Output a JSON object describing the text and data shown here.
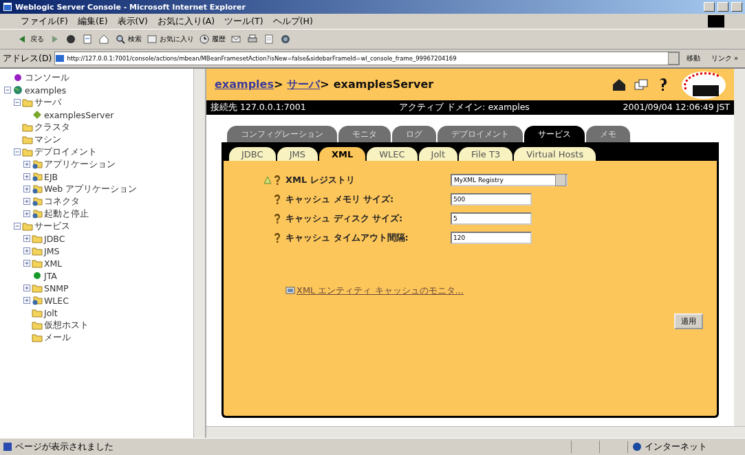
{
  "window": {
    "title": "Weblogic Server Console - Microsoft Internet Explorer"
  },
  "menu": [
    "ファイル(F)",
    "編集(E)",
    "表示(V)",
    "お気に入り(A)",
    "ツール(T)",
    "ヘルプ(H)"
  ],
  "toolbar": [
    {
      "kind": "back",
      "label": "戻る"
    },
    {
      "kind": "forward"
    },
    {
      "kind": "stop"
    },
    {
      "kind": "refresh"
    },
    {
      "kind": "home"
    },
    {
      "kind": "search",
      "label": "検索"
    },
    {
      "kind": "favorites",
      "label": "お気に入り"
    },
    {
      "kind": "history",
      "label": "履歴"
    },
    {
      "kind": "mail"
    },
    {
      "kind": "print"
    },
    {
      "kind": "edit"
    },
    {
      "kind": "messenger"
    }
  ],
  "address": {
    "label": "アドレス(D)",
    "value": "http://127.0.0.1:7001/console/actions/mbean/MBeanFramesetAction?isNew=false&sidebarFrameId=wl_console_frame_99967204169",
    "go": "移動",
    "links": "リンク »"
  },
  "tree": [
    {
      "label": "コンソール",
      "kind": "bullet",
      "color": "#9a1fc4"
    },
    {
      "label": "examples",
      "kind": "globe",
      "expanded": true,
      "children": [
        {
          "label": "サーバ",
          "kind": "folder",
          "expanded": true,
          "children": [
            {
              "label": "examplesServer",
              "kind": "diamond"
            }
          ]
        },
        {
          "label": "クラスタ",
          "kind": "folder"
        },
        {
          "label": "マシン",
          "kind": "folder"
        },
        {
          "label": "デプロイメント",
          "kind": "folder",
          "expanded": true,
          "children": [
            {
              "label": "アプリケーション",
              "kind": "app",
              "expanded": false
            },
            {
              "label": "EJB",
              "kind": "app",
              "expanded": false
            },
            {
              "label": "Web アプリケーション",
              "kind": "app",
              "expanded": false
            },
            {
              "label": "コネクタ",
              "kind": "app",
              "expanded": false
            },
            {
              "label": "起動と停止",
              "kind": "app",
              "expanded": false
            }
          ]
        },
        {
          "label": "サービス",
          "kind": "folder",
          "expanded": true,
          "children": [
            {
              "label": "JDBC",
              "kind": "folder",
              "expanded": false
            },
            {
              "label": "JMS",
              "kind": "folder",
              "expanded": false
            },
            {
              "label": "XML",
              "kind": "folder",
              "expanded": false
            },
            {
              "label": "JTA",
              "kind": "bullet",
              "color": "#1a9a2a"
            },
            {
              "label": "SNMP",
              "kind": "folder",
              "expanded": false
            },
            {
              "label": "WLEC",
              "kind": "app",
              "expanded": false
            },
            {
              "label": "Jolt",
              "kind": "folder"
            },
            {
              "label": "仮想ホスト",
              "kind": "folder"
            },
            {
              "label": "メール",
              "kind": "folder"
            }
          ]
        }
      ]
    }
  ],
  "breadcrumb": [
    {
      "label": "examples",
      "kind": "link",
      "separator": ">"
    },
    {
      "label": "サーバ",
      "kind": "link",
      "separator": ">"
    },
    {
      "label": "examplesServer",
      "kind": "current"
    }
  ],
  "info_bar": {
    "connection": "接続先 127.0.0.1:7001",
    "domain": "アクティブ ドメイン: examples",
    "time": "2001/09/04 12:06:49 JST"
  },
  "tabs": [
    {
      "label": "コンフィグレーション",
      "selected": false
    },
    {
      "label": "モニタ",
      "selected": false
    },
    {
      "label": "ログ",
      "selected": false
    },
    {
      "label": "デプロイメント",
      "selected": false
    },
    {
      "label": "サービス",
      "selected": true
    },
    {
      "label": "メモ",
      "selected": false
    }
  ],
  "subtabs": [
    {
      "label": "JDBC",
      "selected": false
    },
    {
      "label": "JMS",
      "selected": false
    },
    {
      "label": "XML",
      "selected": true
    },
    {
      "label": "WLEC",
      "selected": false
    },
    {
      "label": "Jolt",
      "selected": false
    },
    {
      "label": "File T3",
      "selected": false
    },
    {
      "label": "Virtual Hosts",
      "selected": false
    }
  ],
  "form": [
    {
      "label": "XML レジストリ",
      "kind": "select",
      "value": "MyXML Registry",
      "warning": true
    },
    {
      "label": "キャッシュ メモリ サイズ:",
      "kind": "text",
      "value": "500",
      "warning": false
    },
    {
      "label": "キャッシュ ディスク サイズ:",
      "kind": "text",
      "value": "5",
      "warning": false
    },
    {
      "label": "キャッシュ タイムアウト間隔:",
      "kind": "text",
      "value": "120",
      "warning": false
    }
  ],
  "monitor_link": "XML エンティティ キャッシュのモニタ...",
  "apply_button": "適用",
  "status_bar": {
    "message": "ページが表示されました",
    "zone": "インターネット"
  }
}
